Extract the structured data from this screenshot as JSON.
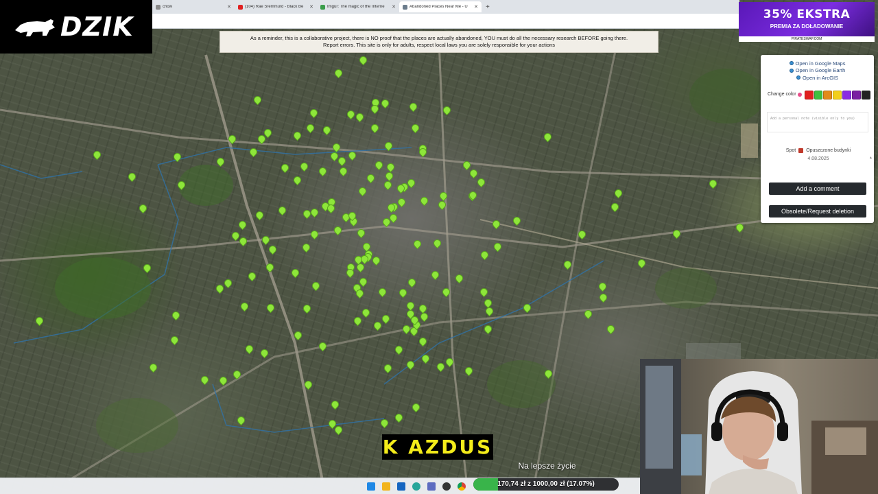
{
  "browser": {
    "tabs": [
      {
        "label": "chów",
        "fav_color": "#8a8a8a",
        "active": false
      },
      {
        "label": "(104) Rae Sremmurd - Black Be",
        "fav_color": "#e02020",
        "active": false
      },
      {
        "label": "Imgur: The magic of the Interne",
        "fav_color": "#3a9d4a",
        "active": false
      },
      {
        "label": "Abandoned Places Near Me - U",
        "fav_color": "#6b7c8c",
        "active": true
      }
    ],
    "new_tab": "+"
  },
  "banner": {
    "line1": "As a reminder, this is a collaborative project, there is NO proof that the places are actually abandoned, YOU must do all the necessary research BEFORE going there.",
    "line2": "Report errors. This site is only for adults, respect local laws you are solely responsible for your actions"
  },
  "logo": {
    "text": "DZIK",
    "icon": "boar-icon"
  },
  "ad": {
    "headline": "35% EKSTRA",
    "sub": "PREMIA ZA DOŁADOWANIE",
    "brand": "PIRATESWAP.COM"
  },
  "panel": {
    "links": [
      "Open in Google Maps",
      "Open in Google Earth",
      "Open in ArcGIS"
    ],
    "change_color_label": "Change color",
    "colors": [
      "#e84d8a",
      "#e02020",
      "#3fbf3f",
      "#e38a1b",
      "#f2cf1c",
      "#8a2be2",
      "#7a1fa2",
      "#222222"
    ],
    "note_placeholder": "Add a personal note (visible only to you)",
    "spot_prefix": "Spot",
    "spot_name": "Opuszczone budynki",
    "spot_date": "4.08.2025",
    "add_comment": "Add a comment",
    "obsolete": "Obsolete/Request deletion"
  },
  "caption": "K AZDUS",
  "song": "Na lepsze życie",
  "donation": {
    "text": "170,74 zł z 1000,00 zł (17.07%)",
    "progress_percent": 17.07
  },
  "colors": {
    "pin": "#8ee63a",
    "accent": "#39b44a",
    "caption": "#f4ec1a"
  }
}
